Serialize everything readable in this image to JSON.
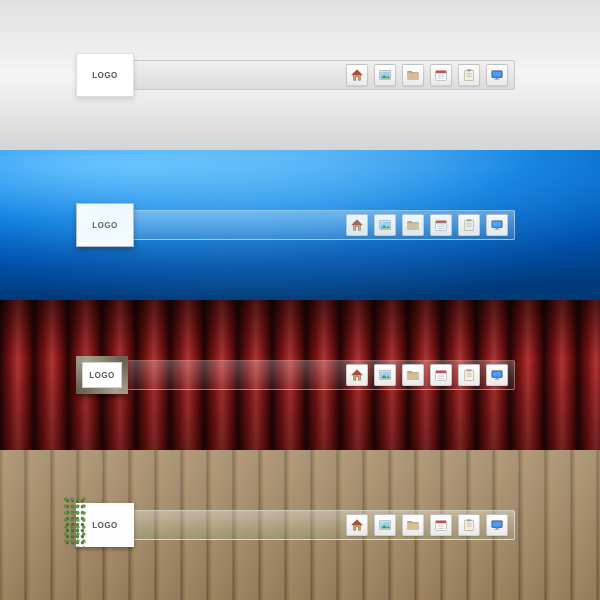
{
  "logo_text": "LOGO",
  "variants": [
    {
      "id": "light",
      "navbar_class": "navbar-1",
      "logo_class": "logo-1"
    },
    {
      "id": "blue",
      "navbar_class": "navbar-2",
      "logo_class": "logo-2"
    },
    {
      "id": "curtain",
      "navbar_class": "navbar-3",
      "logo_class": "logo-3"
    },
    {
      "id": "wood",
      "navbar_class": "navbar-4",
      "logo_class": "logo-4"
    }
  ],
  "nav_icons": [
    {
      "name": "home-icon",
      "label": "Home"
    },
    {
      "name": "photo-icon",
      "label": "Pictures"
    },
    {
      "name": "folder-icon",
      "label": "Folder"
    },
    {
      "name": "calendar-icon",
      "label": "Calendar"
    },
    {
      "name": "clipboard-icon",
      "label": "Notes"
    },
    {
      "name": "monitor-icon",
      "label": "Desktop"
    }
  ]
}
